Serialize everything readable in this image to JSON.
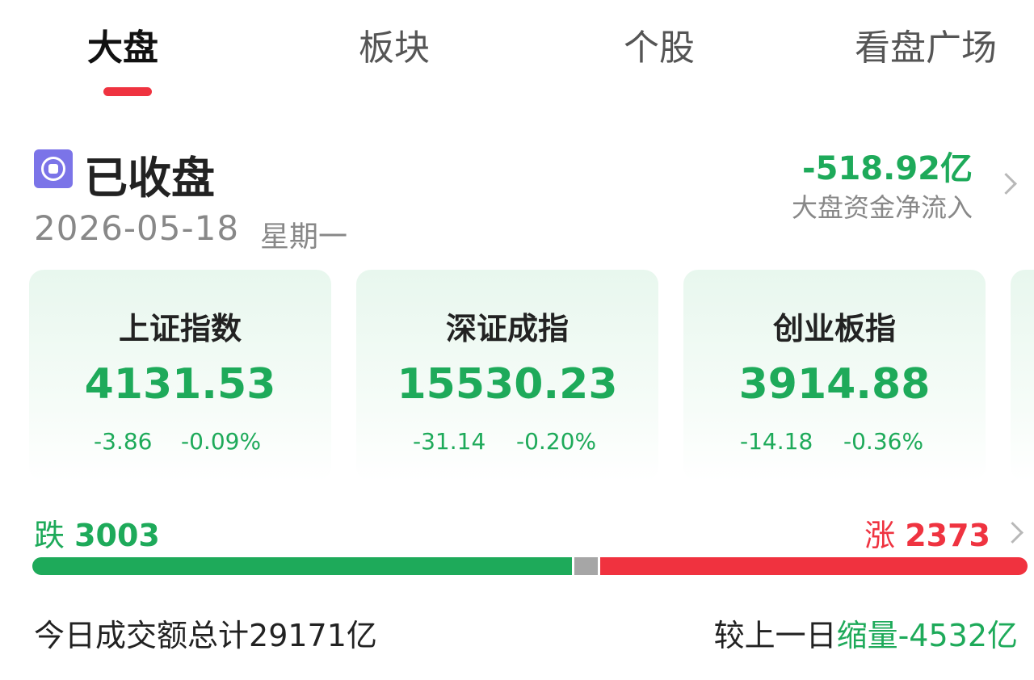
{
  "tabs": [
    {
      "label": "大盘",
      "active": true
    },
    {
      "label": "板块",
      "active": false
    },
    {
      "label": "个股",
      "active": false
    },
    {
      "label": "看盘广场",
      "active": false
    }
  ],
  "status": {
    "icon": "market-closed-icon",
    "text": "已收盘",
    "date": "2026-05-18",
    "weekday": "星期一"
  },
  "net_flow": {
    "value": "-518.92亿",
    "label": "大盘资金净流入"
  },
  "indices": [
    {
      "name": "上证指数",
      "value": "4131.53",
      "change": "-3.86",
      "pct": "-0.09%"
    },
    {
      "name": "深证成指",
      "value": "15530.23",
      "change": "-31.14",
      "pct": "-0.20%"
    },
    {
      "name": "创业板指",
      "value": "3914.88",
      "change": "-14.18",
      "pct": "-0.36%"
    }
  ],
  "breadth": {
    "down_label": "跌",
    "down_count": "3003",
    "up_label": "涨",
    "up_count": "2373"
  },
  "turnover": {
    "label": "今日成交额总计",
    "value": "29171亿",
    "compare_label": "较上一日",
    "compare_value": "缩量-4532亿"
  },
  "colors": {
    "up": "#ef3340",
    "down": "#1eaa5a",
    "flat": "#a6a6a6",
    "accent": "#ef3340",
    "status_icon": "#7b74e8"
  }
}
